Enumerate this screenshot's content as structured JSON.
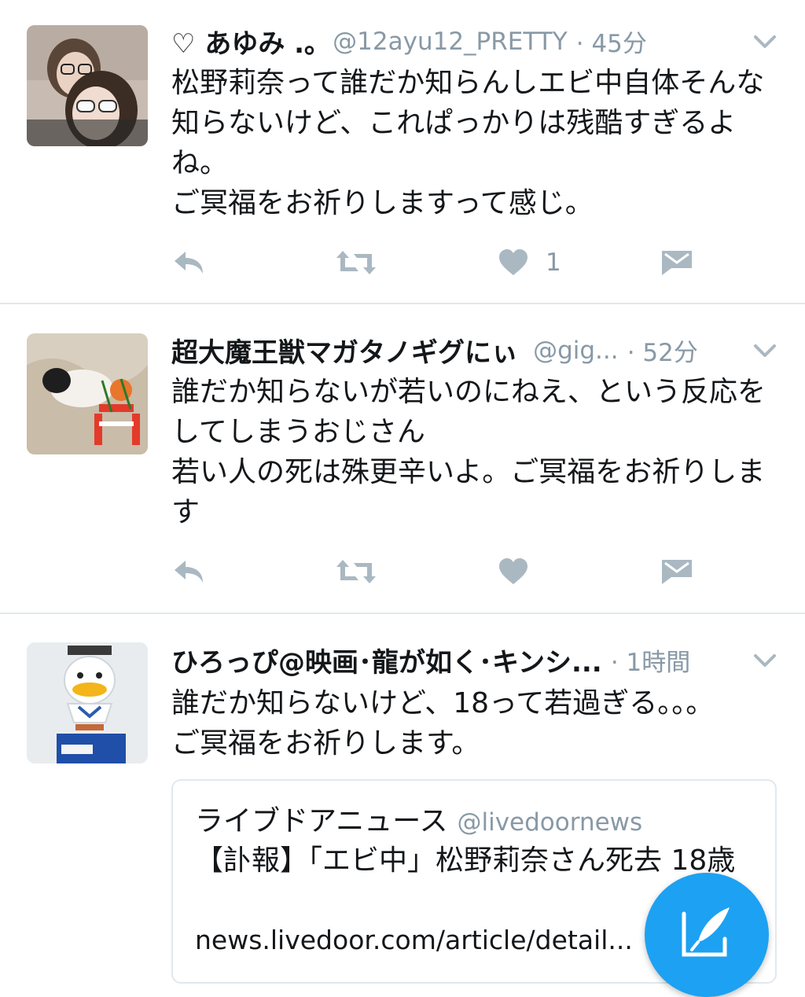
{
  "tweets": [
    {
      "name": "♡ あゆみ .｡",
      "handle": "@12ayu12_PRETTY",
      "time": "· 45分",
      "text": "松野莉奈って誰だか知らんしエビ中自体そんな知らないけど、これぱっかりは残酷すぎるよね。\nご冥福をお祈りしますって感じ。",
      "like_count": "1",
      "avatar_icon": "selfie-photo"
    },
    {
      "name": "超大魔王獣マガタノギグにぃ",
      "handle": "@gig...",
      "time": "· 52分",
      "text": "誰だか知らないが若いのにねえ、という反応をしてしまうおじさん\n若い人の死は殊更辛いよ。ご冥福をお祈りします",
      "like_count": "",
      "avatar_icon": "cat-photo"
    },
    {
      "name": "ひろっぴ@映画･龍が如く･キンシ...",
      "handle": "",
      "time": "· 1時間",
      "text": "誰だか知らないけど、18って若過ぎる。。。\nご冥福をお祈りします。",
      "avatar_icon": "duck-mascot-photo",
      "card": {
        "name": "ライブドアニュース",
        "handle": "@livedoornews",
        "title": "【訃報】「エビ中」松野莉奈さん死去 18歳",
        "url": "news.livedoor.com/article/detail..."
      }
    }
  ],
  "icons": {
    "reply": "reply-icon",
    "retweet": "retweet-icon",
    "like": "heart-icon",
    "dm": "direct-message-icon",
    "more": "chevron-down-icon",
    "compose": "compose-tweet-icon"
  },
  "colors": {
    "accent": "#1da1f2",
    "muted": "#8899a6",
    "icon": "#aab8c2",
    "divider": "#e1e8ed"
  }
}
